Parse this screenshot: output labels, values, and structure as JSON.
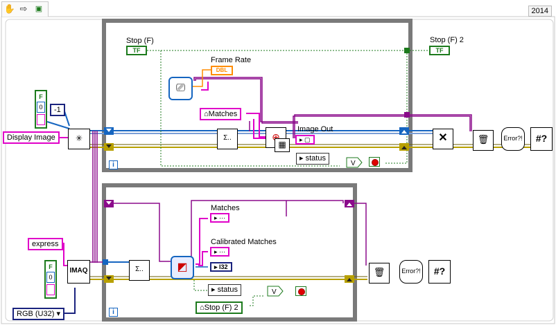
{
  "version": "2014",
  "toolbar": {
    "hand_icon": "hand-pointer-icon",
    "arrow_icon": "run-arrow-icon",
    "probe_icon": "probe-icon"
  },
  "top_loop": {
    "stop_in": "Stop (F)",
    "stop_out": "Stop (F) 2",
    "frame_rate": "Frame Rate",
    "frame_rate_type": "DBL",
    "matches": "Matches",
    "image_out": "Image Out",
    "status": "status",
    "iteration": "i"
  },
  "bottom_loop": {
    "matches": "Matches",
    "calibrated_matches": "Calibrated Matches",
    "i32": "I32",
    "status": "status",
    "stop_ref": "Stop (F) 2",
    "iteration": "i"
  },
  "left_controls": {
    "display_image": "Display Image",
    "minus_one": "-1",
    "bool_label": "F",
    "zero": "0",
    "express": "express",
    "imaq": "IMAQ",
    "rgb": "RGB (U32)"
  },
  "tf_label": "TF",
  "colors": {
    "loop_frame": "#7a7a7a",
    "image_wire": "#8b0a8b",
    "error_wire": "#b8a000",
    "bool_wire": "#1c7a1c",
    "refnum_wire": "#1565c0"
  }
}
